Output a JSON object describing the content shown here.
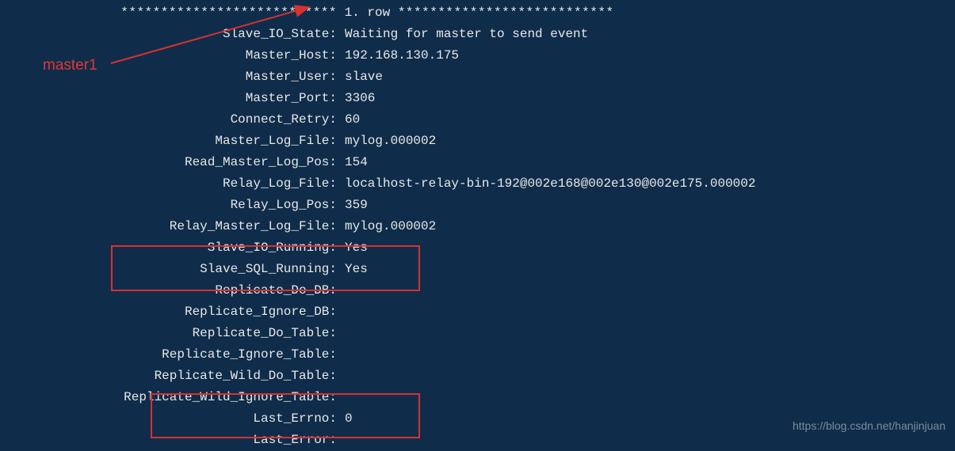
{
  "annotation": "master1",
  "header": {
    "stars_left": "***************************",
    "label": " 1. row ",
    "stars_right": "***************************"
  },
  "rows": [
    {
      "label": "Slave_IO_State:",
      "value": "Waiting for master to send event"
    },
    {
      "label": "Master_Host:",
      "value": "192.168.130.175"
    },
    {
      "label": "Master_User:",
      "value": "slave"
    },
    {
      "label": "Master_Port:",
      "value": "3306"
    },
    {
      "label": "Connect_Retry:",
      "value": "60"
    },
    {
      "label": "Master_Log_File:",
      "value": "mylog.000002"
    },
    {
      "label": "Read_Master_Log_Pos:",
      "value": "154"
    },
    {
      "label": "Relay_Log_File:",
      "value": "localhost-relay-bin-192@002e168@002e130@002e175.000002"
    },
    {
      "label": "Relay_Log_Pos:",
      "value": "359"
    },
    {
      "label": "Relay_Master_Log_File:",
      "value": "mylog.000002"
    },
    {
      "label": "Slave_IO_Running:",
      "value": "Yes"
    },
    {
      "label": "Slave_SQL_Running:",
      "value": "Yes"
    },
    {
      "label": "Replicate_Do_DB:",
      "value": ""
    },
    {
      "label": "Replicate_Ignore_DB:",
      "value": ""
    },
    {
      "label": "Replicate_Do_Table:",
      "value": ""
    },
    {
      "label": "Replicate_Ignore_Table:",
      "value": ""
    },
    {
      "label": "Replicate_Wild_Do_Table:",
      "value": ""
    },
    {
      "label": "Replicate_Wild_Ignore_Table:",
      "value": ""
    },
    {
      "label": "Last_Errno:",
      "value": "0"
    },
    {
      "label": "Last_Error:",
      "value": ""
    }
  ],
  "watermark": "https://blog.csdn.net/hanjinjuan"
}
